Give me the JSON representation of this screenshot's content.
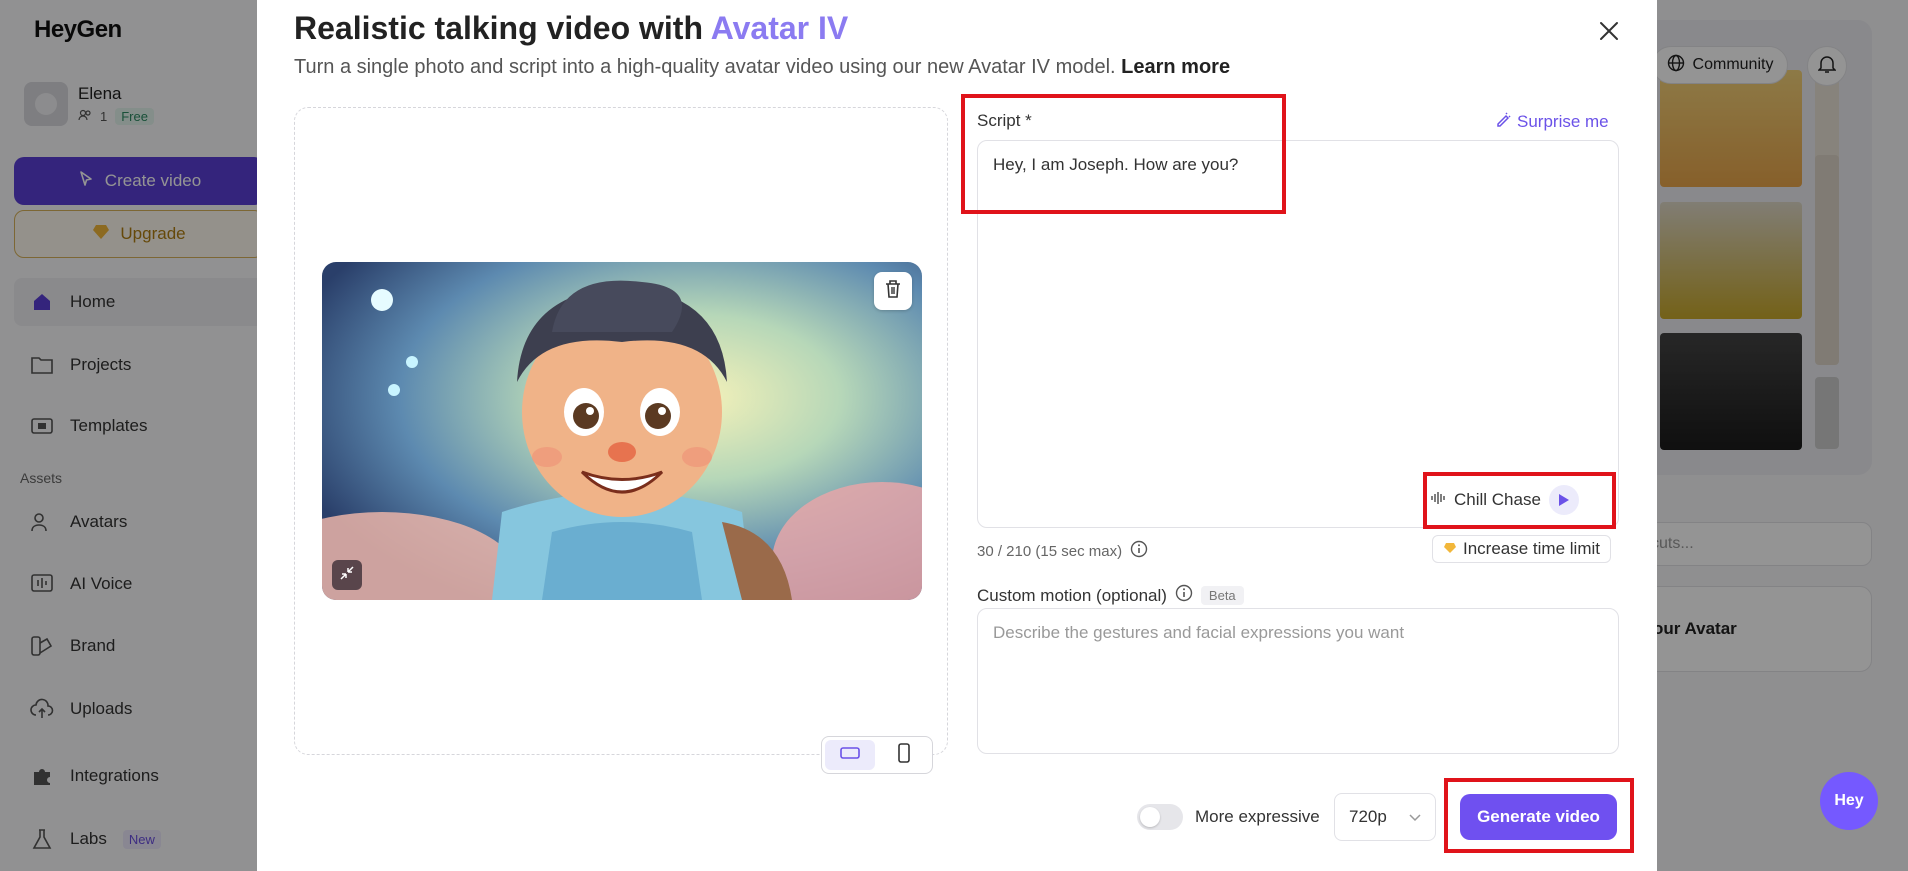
{
  "app": {
    "logo": "HeyGen",
    "user": {
      "name": "Elena",
      "members": "1",
      "plan": "Free"
    },
    "create_video": "Create video",
    "upgrade": "Upgrade",
    "nav": [
      {
        "label": "Home",
        "icon": "home-icon"
      },
      {
        "label": "Projects",
        "icon": "folder-icon"
      },
      {
        "label": "Templates",
        "icon": "film-icon"
      }
    ],
    "assets_label": "Assets",
    "assets": [
      {
        "label": "Avatars",
        "icon": "avatar-icon"
      },
      {
        "label": "AI Voice",
        "icon": "voice-icon"
      },
      {
        "label": "Brand",
        "icon": "brand-icon"
      },
      {
        "label": "Uploads",
        "icon": "upload-icon"
      },
      {
        "label": "Integrations",
        "icon": "puzzle-icon"
      },
      {
        "label": "Labs",
        "icon": "flask-icon",
        "badge": "New"
      }
    ],
    "community": "Community",
    "search_partial": "cuts...",
    "avatar_card_partial": "our Avatar",
    "hey_bubble": "Hey"
  },
  "modal": {
    "title_prefix": "Realistic talking video with ",
    "title_accent": "Avatar IV",
    "subtitle": "Turn a single photo and script into a high-quality avatar video using our new Avatar IV model.",
    "learn_more": "Learn more",
    "script_label": "Script *",
    "surprise_me": "Surprise me",
    "script_text": "Hey, I am Joseph. How are you?",
    "voice_name": "Chill Chase",
    "char_count": "30 / 210 (15 sec max)",
    "increase_limit": "Increase time limit",
    "motion_label": "Custom motion (optional)",
    "motion_badge": "Beta",
    "motion_placeholder": "Describe the gestures and facial expressions you want",
    "more_expressive": "More expressive",
    "resolution": "720p",
    "generate": "Generate video",
    "accent_color": "#8b7bf1",
    "primary_color": "#6f50f0"
  }
}
